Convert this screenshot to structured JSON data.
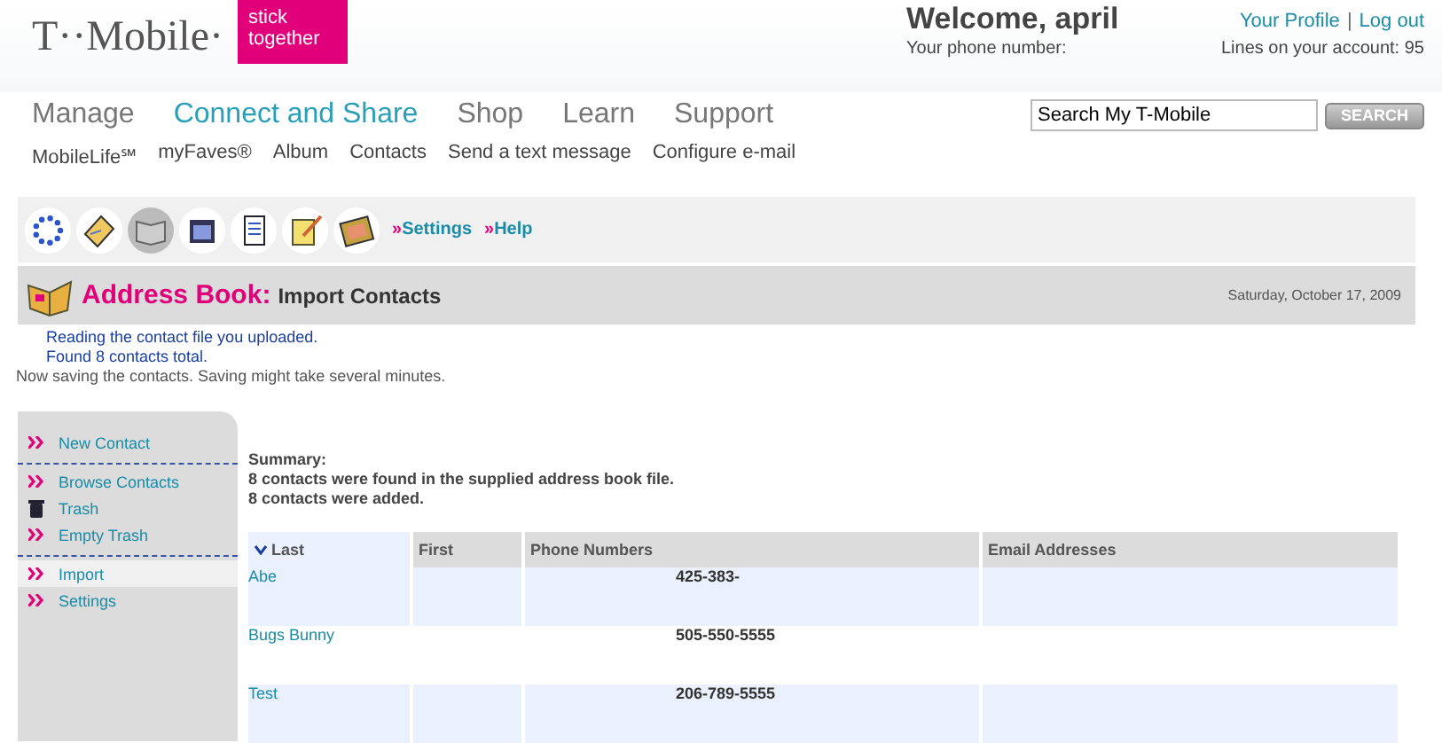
{
  "header": {
    "logo": "T··Mobile·",
    "slogan": "stick together",
    "welcome": "Welcome, april",
    "links": [
      "Your Profile",
      "Log out"
    ],
    "link_separator": "|",
    "phone_label": "Your phone number:",
    "lines": "Lines on your account: 95"
  },
  "nav": [
    {
      "label": "Manage",
      "selected": false
    },
    {
      "label": "Connect and Share",
      "selected": true
    },
    {
      "label": "Shop",
      "selected": false
    },
    {
      "label": "Learn",
      "selected": false
    },
    {
      "label": "Support",
      "selected": false
    }
  ],
  "subnav": [
    "MobileLife℠",
    "myFaves®",
    "Album",
    "Contacts",
    "Send a text message",
    "Configure e-mail"
  ],
  "search": {
    "value": "Search My T-Mobile",
    "button": "SEARCH"
  },
  "toolbar": {
    "tools": [
      {
        "kind": "dots",
        "selected": false
      },
      {
        "kind": "envelope",
        "selected": false
      },
      {
        "kind": "book",
        "selected": true
      },
      {
        "kind": "calendar",
        "selected": false
      },
      {
        "kind": "notepad",
        "selected": false
      },
      {
        "kind": "pencil",
        "selected": false
      },
      {
        "kind": "photo",
        "selected": false
      }
    ],
    "links": [
      {
        "arrow": "»",
        "label": "Settings"
      },
      {
        "arrow": "»",
        "label": "Help"
      }
    ]
  },
  "title_bar": {
    "section": "Address Book:",
    "page": "Import Contacts",
    "date": "Saturday, October 17, 2009"
  },
  "messages": [
    "Reading the contact file you uploaded.",
    "Found 8 contacts total."
  ],
  "notice": "Now saving the contacts. Saving might take several minutes.",
  "sidebar": {
    "groups": [
      [
        {
          "kind": "arrow",
          "label": "New Contact",
          "selected": false
        }
      ],
      [
        {
          "kind": "arrow",
          "label": "Browse Contacts",
          "selected": false
        },
        {
          "kind": "trash",
          "label": "Trash",
          "selected": false
        },
        {
          "kind": "arrow",
          "label": "Empty Trash",
          "selected": false
        }
      ],
      [
        {
          "kind": "arrow",
          "label": "Import",
          "selected": true
        },
        {
          "kind": "arrow",
          "label": "Settings",
          "selected": false
        }
      ]
    ]
  },
  "summary": {
    "title": "Summary:",
    "lines": [
      "8 contacts were found in the supplied address book file.",
      "8 contacts were added."
    ]
  },
  "table": {
    "columns": [
      {
        "label": "Last",
        "sorted": true
      },
      {
        "label": "First",
        "sorted": false
      },
      {
        "label": "Phone Numbers",
        "sorted": false
      },
      {
        "label": "Email Addresses",
        "sorted": false
      }
    ],
    "rows": [
      {
        "last": "Abe",
        "phone": "425-383-"
      },
      {
        "last": "Bugs Bunny",
        "phone": "505-550-5555"
      },
      {
        "last": "Test",
        "phone": "206-789-5555"
      }
    ]
  }
}
